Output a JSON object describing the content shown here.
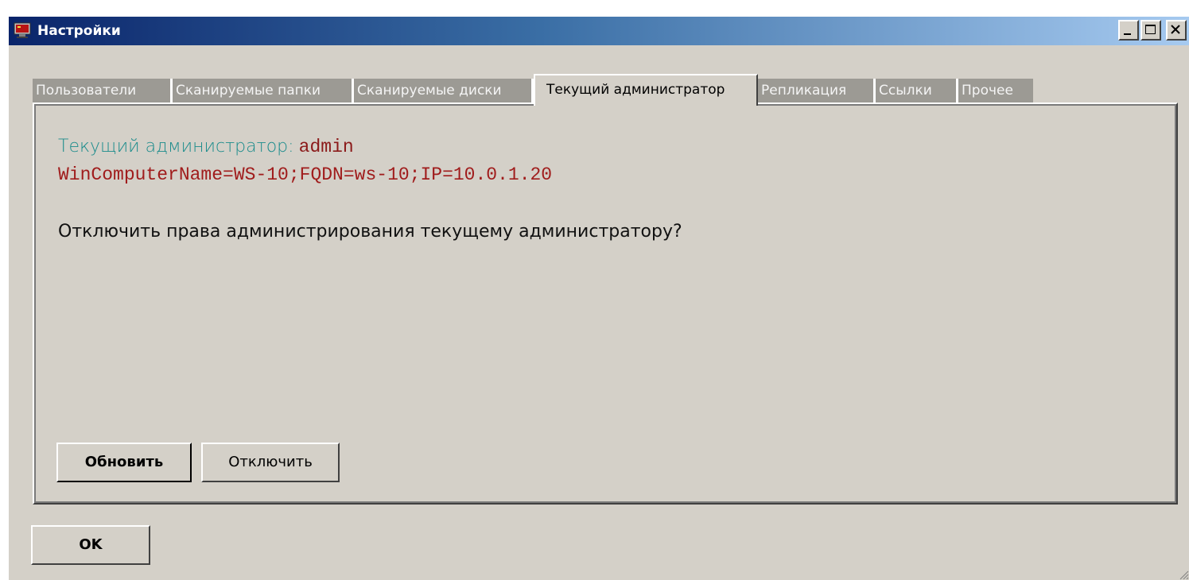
{
  "window": {
    "title": "Настройки",
    "icon": "monitor-icon",
    "controls": {
      "minimize": "minimize-icon",
      "maximize": "maximize-icon",
      "close": "close-icon"
    }
  },
  "tabs": [
    {
      "label": "Пользователи",
      "active": false
    },
    {
      "label": "Сканируемые папки",
      "active": false
    },
    {
      "label": "Сканируемые диски",
      "active": false
    },
    {
      "label": "Текущий администратор",
      "active": true
    },
    {
      "label": "Репликация",
      "active": false
    },
    {
      "label": "Ссылки",
      "active": false
    },
    {
      "label": "Прочее",
      "active": false
    }
  ],
  "panel": {
    "admin_label": "Текущий администратор:",
    "admin_value": "admin",
    "computer_info": "WinComputerName=WS-10;FQDN=ws-10;IP=10.0.1.20",
    "question": "Отключить права администрирования текущему администратору?",
    "refresh_button": "Обновить",
    "disable_button": "Отключить"
  },
  "footer": {
    "ok_button": "OK"
  },
  "colors": {
    "titlebar_start": "#0a246a",
    "titlebar_end": "#a6caf0",
    "face": "#d4d0c8",
    "admin_label": "#1c8c8c",
    "admin_value": "#8b1a1a"
  }
}
